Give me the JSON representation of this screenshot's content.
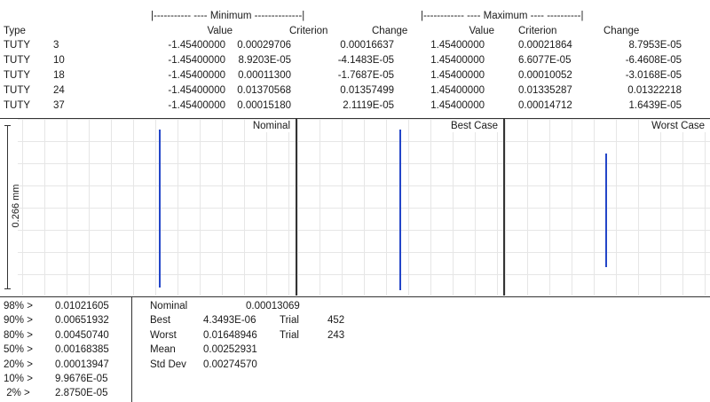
{
  "header": {
    "min_group": "|-----------        ---- Minimum --------------|",
    "max_group": "|------------        ---- Maximum ----          ----------|",
    "type_label": "Type",
    "min_value": "Value",
    "min_criterion": "Criterion",
    "min_change": "Change",
    "max_value": "Value",
    "max_criterion": "Criterion",
    "max_change": "Change"
  },
  "rows": [
    {
      "type": "TUTY",
      "num": "3",
      "min_value": "-1.45400000",
      "min_criterion": "0.00029706",
      "min_change": "0.00016637",
      "max_value": "1.45400000",
      "max_criterion": "0.00021864",
      "max_change": "8.7953E-05"
    },
    {
      "type": "TUTY",
      "num": "10",
      "min_value": "-1.45400000",
      "min_criterion": "8.9203E-05",
      "min_change": "-4.1483E-05",
      "max_value": "1.45400000",
      "max_criterion": "6.6077E-05",
      "max_change": "-6.4608E-05"
    },
    {
      "type": "TUTY",
      "num": "18",
      "min_value": "-1.45400000",
      "min_criterion": "0.00011300",
      "min_change": "-1.7687E-05",
      "max_value": "1.45400000",
      "max_criterion": "0.00010052",
      "max_change": "-3.0168E-05"
    },
    {
      "type": "TUTY",
      "num": "24",
      "min_value": "-1.45400000",
      "min_criterion": "0.01370568",
      "min_change": "0.01357499",
      "max_value": "1.45400000",
      "max_criterion": "0.01335287",
      "max_change": "0.01322218"
    },
    {
      "type": "TUTY",
      "num": "37",
      "min_value": "-1.45400000",
      "min_criterion": "0.00015180",
      "min_change": "2.1119E-05",
      "max_value": "1.45400000",
      "max_criterion": "0.00014712",
      "max_change": "1.6439E-05"
    }
  ],
  "plots": {
    "scale_label": "0.266 mm",
    "panels": [
      {
        "title": "Nominal"
      },
      {
        "title": "Best Case"
      },
      {
        "title": "Worst Case"
      }
    ]
  },
  "percentiles": [
    {
      "label": "98% >",
      "value": "0.01021605"
    },
    {
      "label": "90% >",
      "value": "0.00651932"
    },
    {
      "label": "80% >",
      "value": "0.00450740"
    },
    {
      "label": "50% >",
      "value": "0.00168385"
    },
    {
      "label": "20% >",
      "value": "0.00013947"
    },
    {
      "label": "10% >",
      "value": "9.9676E-05"
    },
    {
      "label": " 2% >",
      "value": "2.8750E-05"
    }
  ],
  "stats": {
    "nominal_label": "Nominal",
    "nominal_value": "0.00013069",
    "best_label": "Best",
    "best_value": "4.3493E-06",
    "best_trial_label": "Trial",
    "best_trial": "452",
    "worst_label": "Worst",
    "worst_value": "0.01648946",
    "worst_trial_label": "Trial",
    "worst_trial": "243",
    "mean_label": "Mean",
    "mean_value": "0.00252931",
    "std_label": "Std Dev",
    "std_value": "0.00274570"
  }
}
